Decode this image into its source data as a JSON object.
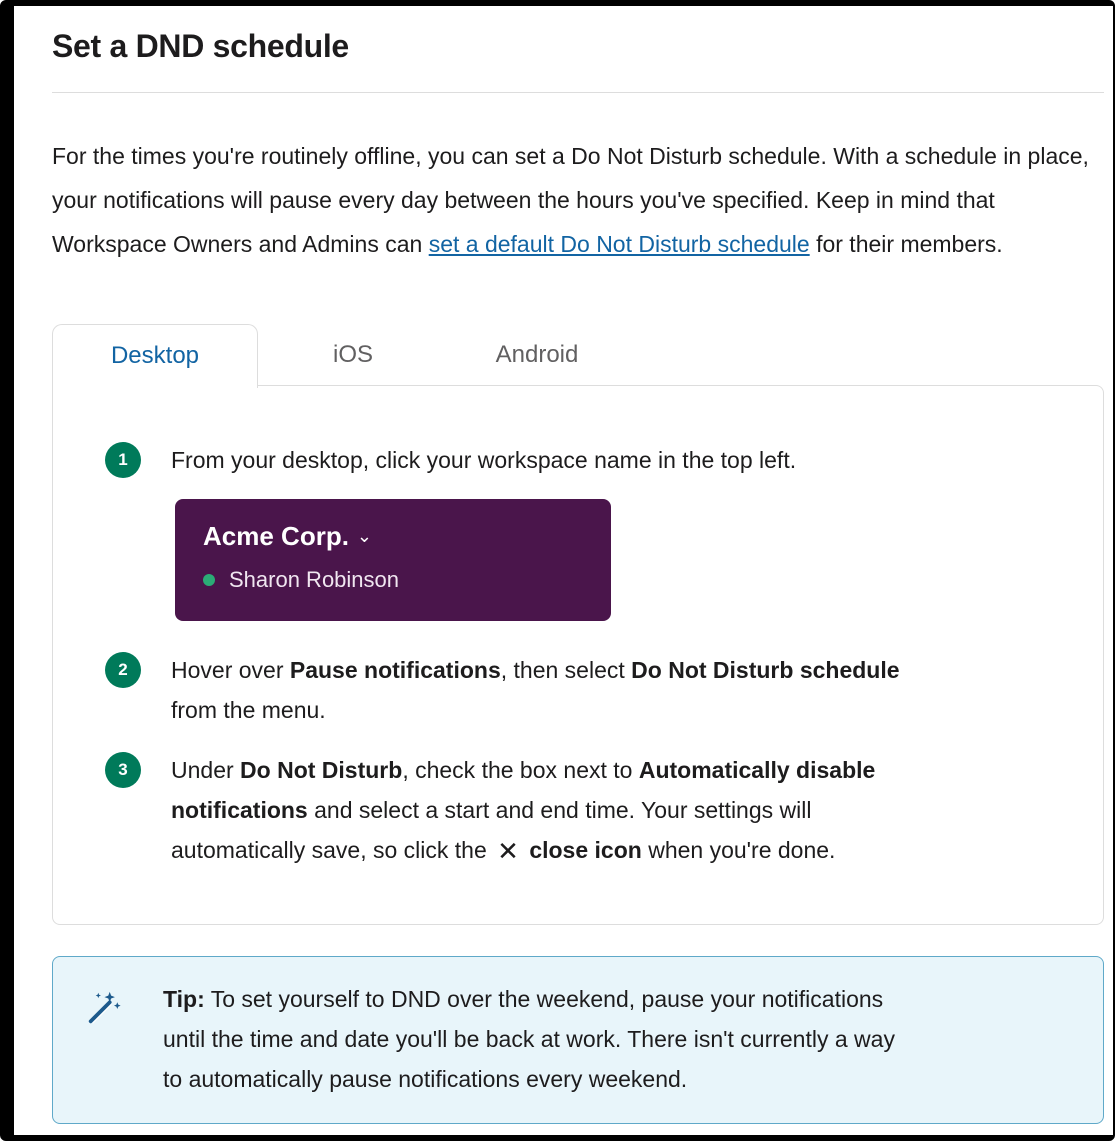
{
  "page": {
    "title": "Set a DND schedule",
    "intro_1": "For the times you're routinely offline, you can set a Do Not Disturb schedule. With a schedule in place, your notifications will pause every day between the hours you've specified. Keep in mind that Workspace Owners and Admins can ",
    "intro_link": "set a default Do Not Disturb schedule",
    "intro_2": " for their members."
  },
  "tabs": [
    {
      "label": "Desktop",
      "active": true
    },
    {
      "label": "iOS",
      "active": false
    },
    {
      "label": "Android",
      "active": false
    }
  ],
  "steps": [
    {
      "number": "1",
      "text": "From your desktop, click your workspace name in the top left."
    },
    {
      "number": "2",
      "pre": "Hover over ",
      "bold1": "Pause notifications",
      "mid": ", then select ",
      "bold2": "Do Not Disturb schedule",
      "post": "from the menu."
    },
    {
      "number": "3",
      "pre": "Under ",
      "bold1": "Do Not Disturb",
      "mid": ", check the box next to ",
      "bold2": "Automatically disable",
      "bold3": "notifications",
      "mid2": " and select a start and end time. Your settings will",
      "line3_pre": "automatically save, so click the ",
      "close_glyph": "✕",
      "bold4": "close icon",
      "line3_post": " when you're done."
    }
  ],
  "workspace_card": {
    "name": "Acme Corp.",
    "caret": "⌄",
    "user": "Sharon Robinson",
    "bg_color": "#4a154b",
    "status_color": "#2bac76"
  },
  "tip": {
    "label": "Tip:",
    "text_1": " To set yourself to DND over the weekend, pause your notifications",
    "text_2": "until the time and date you'll be back at work. There isn't currently a way",
    "text_3": "to automatically pause notifications every weekend.",
    "icon": "magic-wand-icon"
  },
  "colors": {
    "link": "#1264a3",
    "step_badge": "#007a5a",
    "tip_bg": "#e8f5fa",
    "tip_border": "#5fa9c9"
  }
}
